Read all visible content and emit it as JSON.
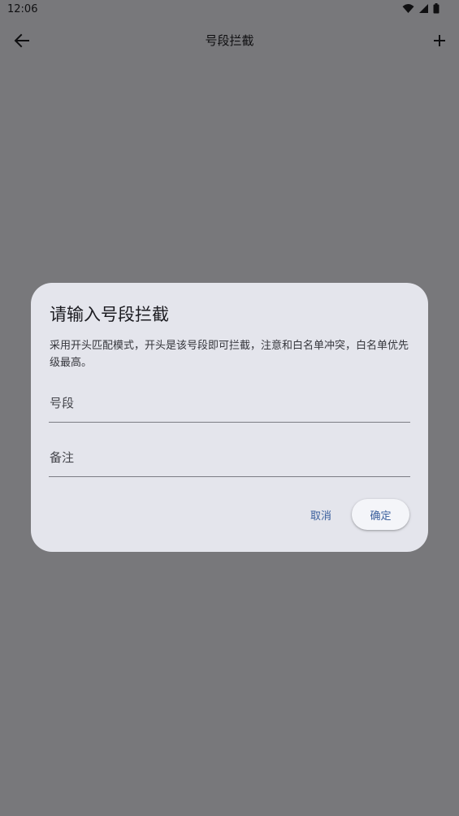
{
  "status_bar": {
    "time": "12:06",
    "icons": [
      "wifi-icon",
      "signal-icon",
      "battery-icon"
    ]
  },
  "app_bar": {
    "title": "号段拦截",
    "back_icon": "back-arrow-icon",
    "add_icon": "add-icon"
  },
  "dialog": {
    "title": "请输入号段拦截",
    "message": "采用开头匹配模式，开头是该号段即可拦截，注意和白名单冲突，白名单优先级最高。",
    "number_field": {
      "value": "",
      "placeholder": "号段"
    },
    "note_field": {
      "value": "",
      "placeholder": "备注"
    },
    "cancel_label": "取消",
    "confirm_label": "确定"
  },
  "colors": {
    "background": "#f1f1f6",
    "dialog_surface": "#e4e5ec",
    "accent": "#3a5f9d",
    "text_primary": "#1c1c21"
  }
}
